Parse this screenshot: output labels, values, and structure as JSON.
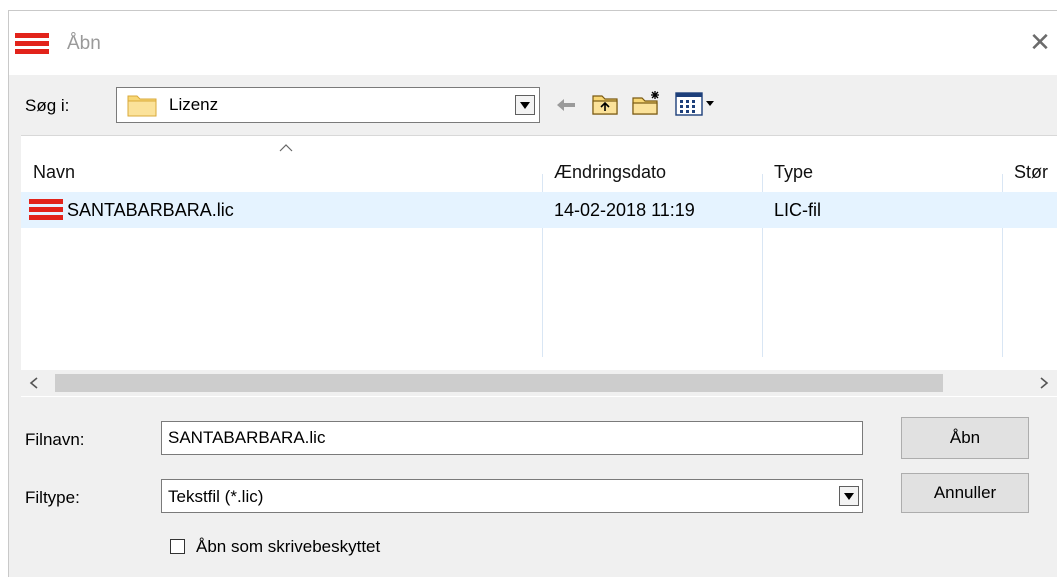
{
  "window": {
    "title": "Åbn"
  },
  "lookin": {
    "label": "Søg i:",
    "value": "Lizenz"
  },
  "toolbar": {
    "back_icon": "back-arrow-icon",
    "up_icon": "up-folder-icon",
    "new_folder_icon": "new-folder-icon",
    "view_icon": "view-menu-icon"
  },
  "list": {
    "columns": [
      "Navn",
      "Ændringsdato",
      "Type",
      "Stør"
    ],
    "rows": [
      {
        "name": "SANTABARBARA.lic",
        "date": "14-02-2018 11:19",
        "type": "LIC-fil"
      }
    ]
  },
  "form": {
    "filename_label": "Filnavn:",
    "filename_value": "SANTABARBARA.lic",
    "filetype_label": "Filtype:",
    "filetype_value": "Tekstfil (*.lic)",
    "readonly_label": "Åbn som skrivebeskyttet"
  },
  "buttons": {
    "open": "Åbn",
    "cancel": "Annuller"
  },
  "colors": {
    "app_icon_red": "#e2231a",
    "selection": "#e5f3ff",
    "folder_yellow": "#f8d775"
  }
}
